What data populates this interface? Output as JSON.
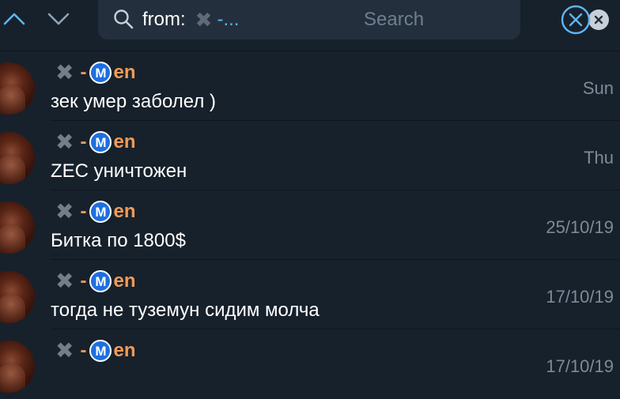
{
  "colors": {
    "background": "#17212b",
    "search_bg": "#242f3d",
    "accent": "#5eb5f7",
    "sender": "#f29b57",
    "date": "#7d8b99",
    "badge": "#1d6fe0"
  },
  "toolbar": {
    "up_icon": "chevron-up-icon",
    "down_icon": "chevron-down-icon",
    "close_icon": "close-circle-icon"
  },
  "search": {
    "filter_label": "from:",
    "filter_icon": "cross-mark-icon",
    "filter_value": "-...",
    "placeholder": "Search",
    "value": "",
    "clear_icon": "clear-icon"
  },
  "results": [
    {
      "sender_icon": "cross-mark-icon",
      "sender_prefix": "-",
      "badge": "M",
      "sender_suffix": "en",
      "message": "зек умер заболел )",
      "date": "Sun"
    },
    {
      "sender_icon": "cross-mark-icon",
      "sender_prefix": "-",
      "badge": "M",
      "sender_suffix": "en",
      "message": "ZEC уничтожен",
      "date": "Thu"
    },
    {
      "sender_icon": "cross-mark-icon",
      "sender_prefix": "-",
      "badge": "M",
      "sender_suffix": "en",
      "message": "Битка по 1800$",
      "date": "25/10/19"
    },
    {
      "sender_icon": "cross-mark-icon",
      "sender_prefix": "-",
      "badge": "M",
      "sender_suffix": "en",
      "message": "тогда не туземун сидим молча",
      "date": "17/10/19"
    },
    {
      "sender_icon": "cross-mark-icon",
      "sender_prefix": "-",
      "badge": "M",
      "sender_suffix": "en",
      "message": "",
      "date": "17/10/19"
    }
  ]
}
